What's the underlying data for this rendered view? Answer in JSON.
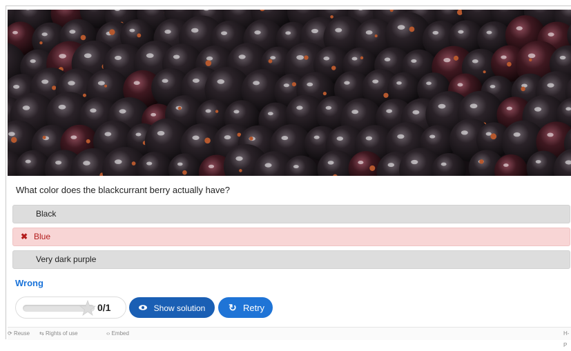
{
  "question": "What color does the blackcurrant berry actually have?",
  "answers": [
    {
      "label": "Black",
      "state": "neutral"
    },
    {
      "label": "Blue",
      "state": "wrong",
      "mark": "✖"
    },
    {
      "label": "Very dark purple",
      "state": "neutral"
    }
  ],
  "feedback": "Wrong",
  "score": {
    "text": "0/1",
    "progress": 0
  },
  "buttons": {
    "show_solution": "Show solution",
    "retry": "Retry"
  },
  "icons": {
    "show_solution": "eye-icon",
    "retry": "retry-icon",
    "score": "star-icon"
  },
  "footer": {
    "reuse": "Reuse",
    "rights": "Rights of use",
    "embed": "Embed",
    "brand": "H-P"
  },
  "colors": {
    "accent": "#1a5fb4",
    "feedback_wrong": "#1a73d9",
    "wrong_bg": "#f8d5d5",
    "wrong_text": "#b31b1b"
  }
}
